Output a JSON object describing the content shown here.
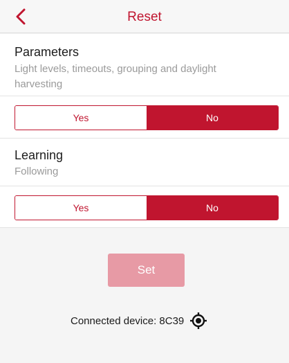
{
  "header": {
    "title": "Reset",
    "back_icon": "chevron-left-icon",
    "accent_color": "#c0152f"
  },
  "parameters": {
    "title": "Parameters",
    "description": "Light levels, timeouts, grouping and daylight harvesting",
    "options": [
      "Yes",
      "No"
    ],
    "selected": "No"
  },
  "learning": {
    "title": "Learning",
    "description": "Following",
    "options": [
      "Yes",
      "No"
    ],
    "selected": "No"
  },
  "actions": {
    "set_label": "Set",
    "set_disabled": true
  },
  "footer": {
    "connected_text": "Connected device: 8C39",
    "locate_icon": "crosshair-target-icon"
  }
}
